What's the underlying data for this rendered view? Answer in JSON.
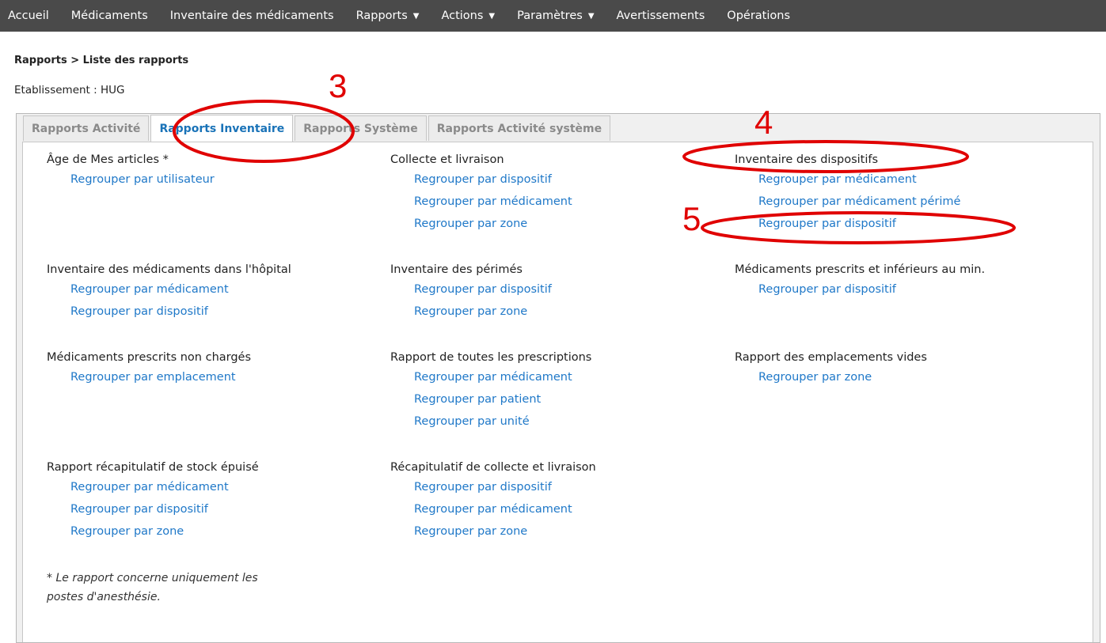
{
  "nav": {
    "items": [
      {
        "label": "Accueil",
        "dropdown": false
      },
      {
        "label": "Médicaments",
        "dropdown": false
      },
      {
        "label": "Inventaire des médicaments",
        "dropdown": false
      },
      {
        "label": "Rapports",
        "dropdown": true
      },
      {
        "label": "Actions",
        "dropdown": true
      },
      {
        "label": "Paramètres",
        "dropdown": true
      },
      {
        "label": "Avertissements",
        "dropdown": false
      },
      {
        "label": "Opérations",
        "dropdown": false
      }
    ]
  },
  "breadcrumb": "Rapports > Liste des rapports",
  "establishment": "Etablissement : HUG",
  "tabs": [
    {
      "label": "Rapports Activité",
      "active": false
    },
    {
      "label": "Rapports Inventaire",
      "active": true
    },
    {
      "label": "Rapports Système",
      "active": false
    },
    {
      "label": "Rapports Activité système",
      "active": false
    }
  ],
  "groups": [
    {
      "title": "Âge de Mes articles *",
      "links": [
        "Regrouper par utilisateur"
      ]
    },
    {
      "title": "Collecte et livraison",
      "links": [
        "Regrouper par dispositif",
        "Regrouper par médicament",
        "Regrouper par zone"
      ]
    },
    {
      "title": "Inventaire des dispositifs",
      "links": [
        "Regrouper par médicament",
        "Regrouper par médicament périmé",
        "Regrouper par dispositif"
      ]
    },
    {
      "title": "Inventaire des médicaments dans l'hôpital",
      "links": [
        "Regrouper par médicament",
        "Regrouper par dispositif"
      ]
    },
    {
      "title": "Inventaire des périmés",
      "links": [
        "Regrouper par dispositif",
        "Regrouper par zone"
      ]
    },
    {
      "title": "Médicaments prescrits et inférieurs au min.",
      "links": [
        "Regrouper par dispositif"
      ]
    },
    {
      "title": "Médicaments prescrits non chargés",
      "links": [
        "Regrouper par emplacement"
      ]
    },
    {
      "title": "Rapport de toutes les prescriptions",
      "links": [
        "Regrouper par médicament",
        "Regrouper par patient",
        "Regrouper par unité"
      ]
    },
    {
      "title": "Rapport des emplacements vides",
      "links": [
        "Regrouper par zone"
      ]
    },
    {
      "title": "Rapport récapitulatif de stock épuisé",
      "links": [
        "Regrouper par médicament",
        "Regrouper par dispositif",
        "Regrouper par zone"
      ]
    },
    {
      "title": "Récapitulatif de collecte et livraison",
      "links": [
        "Regrouper par dispositif",
        "Regrouper par médicament",
        "Regrouper par zone"
      ]
    }
  ],
  "footnote": {
    "line1": "* Le rapport concerne uniquement les",
    "line2": "postes d'anesthésie."
  },
  "annotations": {
    "color": "#e00000",
    "step3": "3",
    "step4": "4",
    "step5": "5"
  }
}
